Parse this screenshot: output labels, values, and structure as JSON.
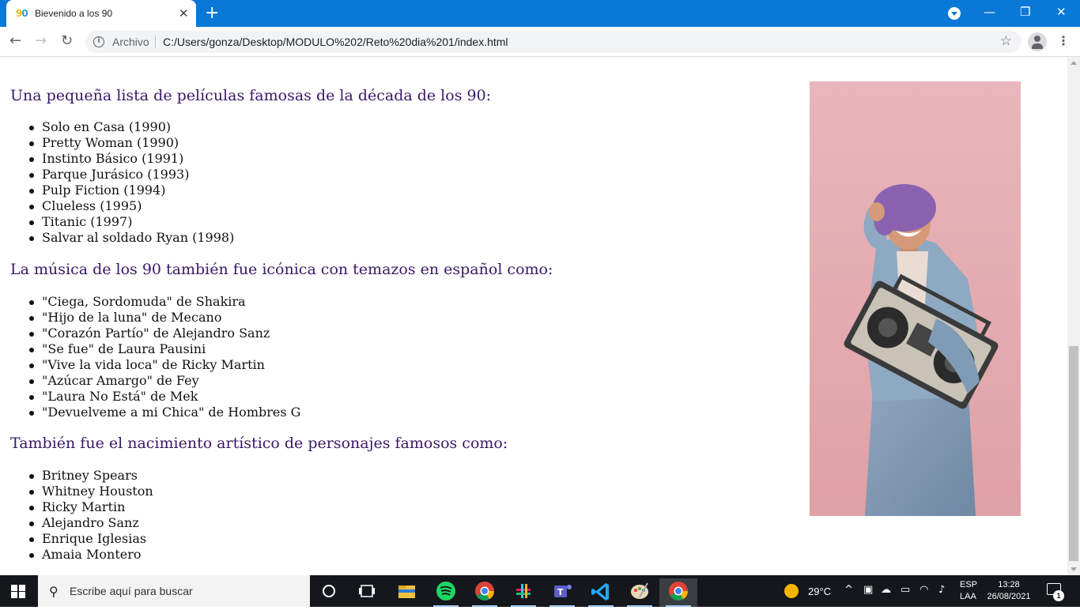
{
  "browser": {
    "tab_title": "Bievenido a los 90",
    "new_tab_label": "+",
    "address_scheme": "Archivo",
    "address_url": "C:/Users/gonza/Desktop/MODULO%202/Reto%20dia%201/index.html"
  },
  "page": {
    "movies": {
      "heading": "Una pequeña lista de películas famosas de la década de los 90:",
      "items": [
        "Solo en Casa (1990)",
        "Pretty Woman (1990)",
        "Instinto Básico (1991)",
        "Parque Jurásico (1993)",
        "Pulp Fiction (1994)",
        "Clueless (1995)",
        "Titanic (1997)",
        "Salvar al soldado Ryan (1998)"
      ]
    },
    "music": {
      "heading": "La música de los 90 también fue icónica con temazos en español como:",
      "items": [
        "\"Ciega, Sordomuda\" de Shakira",
        "\"Hijo de la luna\" de Mecano",
        "\"Corazón Partío\" de Alejandro Sanz",
        "\"Se fue\" de Laura Pausini",
        "\"Vive la vida loca\" de Ricky Martin",
        "\"Azúcar Amargo\" de Fey",
        "\"Laura No Está\" de Mek",
        "\"Devuelveme a mi Chica\" de Hombres G"
      ]
    },
    "artists": {
      "heading": "También fue el nacimiento artístico de personajes famosos como:",
      "items": [
        "Britney Spears",
        "Whitney Houston",
        "Ricky Martin",
        "Alejandro Sanz",
        "Enrique Iglesias",
        "Amaia Montero"
      ]
    },
    "heading_color": "#3a1866"
  },
  "taskbar": {
    "search_placeholder": "Escribe aquí para buscar",
    "apps": [
      "task-view-icon",
      "file-explorer-icon",
      "spotify-icon",
      "chrome-icon",
      "slack-icon",
      "teams-icon",
      "vscode-icon",
      "paint-icon",
      "chrome-active-icon"
    ],
    "temperature": "29°C",
    "language_line1": "ESP",
    "language_line2": "LAA",
    "time": "13:28",
    "date": "26/08/2021",
    "notification_count": "1"
  }
}
